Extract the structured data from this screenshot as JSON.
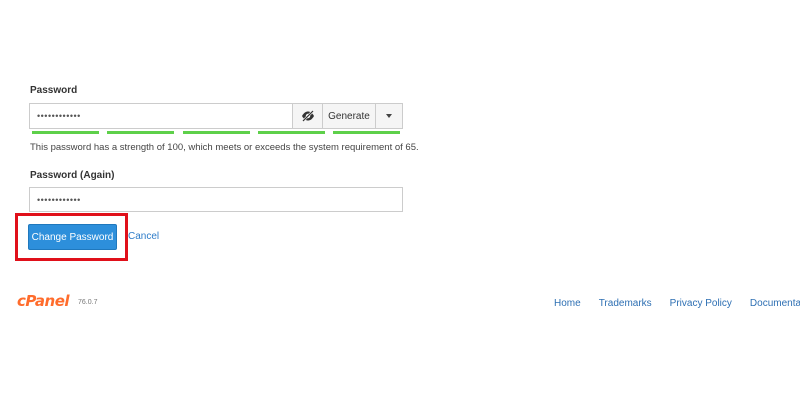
{
  "password_section": {
    "label": "Password",
    "value": "••••••••••••",
    "toggle_icon": "eye-slash-icon",
    "generate_label": "Generate",
    "dropdown_icon": "caret-down-icon",
    "strength_segments_filled": 5,
    "strength_segments_total": 5,
    "strength_color": "#5ed04a",
    "strength_message": "This password has a strength of 100, which meets or exceeds the system requirement of 65."
  },
  "password_again_section": {
    "label": "Password (Again)",
    "value": "••••••••••••"
  },
  "actions": {
    "change_password_label": "Change Password",
    "cancel_label": "Cancel",
    "primary_color": "#2d8fdb",
    "highlight_color": "#e0101a"
  },
  "footer": {
    "brand": "cPanel",
    "version": "76.0.7",
    "brand_color": "#ff6c2c",
    "links": [
      "Home",
      "Trademarks",
      "Privacy Policy",
      "Documentation"
    ]
  }
}
